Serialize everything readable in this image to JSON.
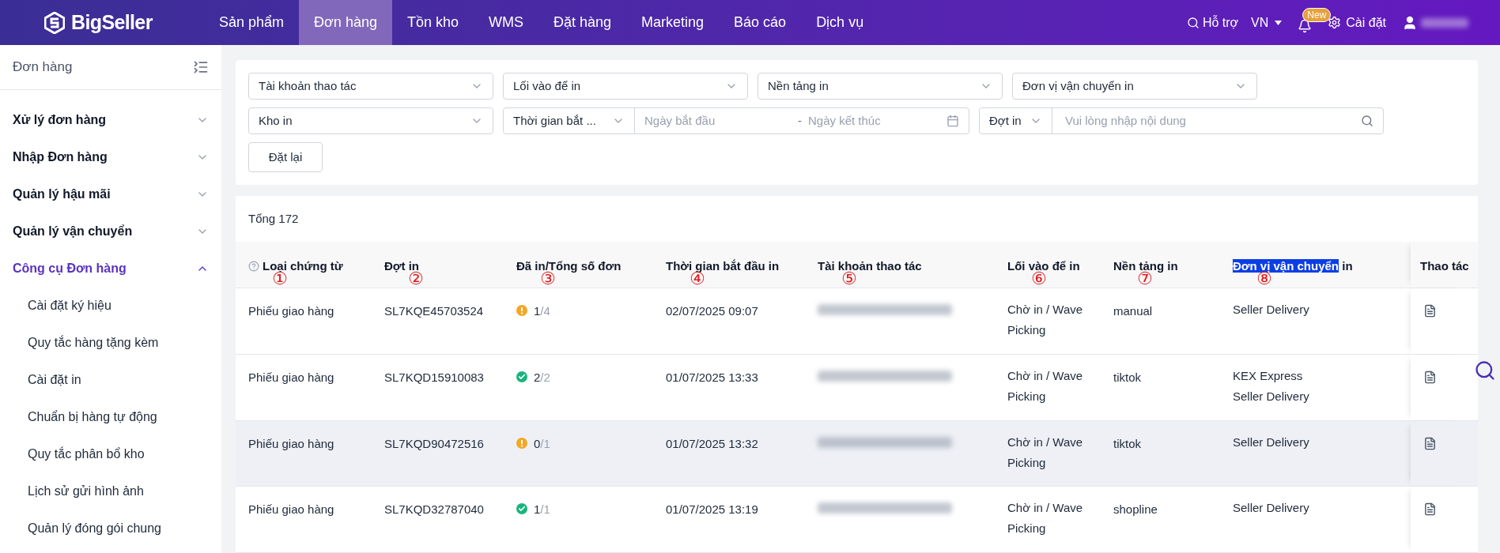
{
  "topnav": {
    "logo": "BigSeller",
    "items": [
      {
        "label": "Sản phẩm",
        "selected": false
      },
      {
        "label": "Đơn hàng",
        "selected": true
      },
      {
        "label": "Tồn kho",
        "selected": false
      },
      {
        "label": "WMS",
        "selected": false
      },
      {
        "label": "Đặt hàng",
        "selected": false
      },
      {
        "label": "Marketing",
        "selected": false
      },
      {
        "label": "Báo cáo",
        "selected": false
      },
      {
        "label": "Dịch vụ",
        "selected": false
      }
    ],
    "help": "Hỗ trợ",
    "language": "VN",
    "notification_badge": "New",
    "settings": "Cài đặt"
  },
  "sidebar": {
    "title": "Đơn hàng",
    "items": [
      {
        "label": "Xử lý đơn hàng",
        "expanded": false
      },
      {
        "label": "Nhập Đơn hàng",
        "expanded": false
      },
      {
        "label": "Quản lý hậu mãi",
        "expanded": false
      },
      {
        "label": "Quản lý vận chuyển",
        "expanded": false
      },
      {
        "label": "Công cụ Đơn hàng",
        "expanded": true,
        "children": [
          {
            "label": "Cài đặt ký hiệu"
          },
          {
            "label": "Quy tắc hàng tặng kèm"
          },
          {
            "label": "Cài đặt in"
          },
          {
            "label": "Chuẩn bị hàng tự động"
          },
          {
            "label": "Quy tắc phân bổ kho"
          },
          {
            "label": "Lịch sử gửi hình ảnh"
          },
          {
            "label": "Quản lý đóng gói chung"
          }
        ]
      }
    ]
  },
  "filters": {
    "row1": [
      {
        "placeholder": "Tài khoản thao tác"
      },
      {
        "placeholder": "Lối vào để in"
      },
      {
        "placeholder": "Nền tảng in"
      },
      {
        "placeholder": "Đơn vị vận chuyển in"
      }
    ],
    "warehouse": {
      "placeholder": "Kho in"
    },
    "date_type": "Thời gian bắt ...",
    "date_start": {
      "placeholder": "Ngày bắt đầu"
    },
    "date_separator": "-",
    "date_end": {
      "placeholder": "Ngày kết thúc"
    },
    "search_type": "Đợt in",
    "search": {
      "placeholder": "Vui lòng nhập nội dung"
    },
    "reset_button": "Đặt lại"
  },
  "table": {
    "total": "Tổng 172",
    "columns": [
      {
        "parts": [
          {
            "text": "Loại chứng từ",
            "highlighted": false
          }
        ],
        "marker": "①",
        "help_icon": true
      },
      {
        "parts": [
          {
            "text": "Đợt in",
            "highlighted": false
          }
        ],
        "marker": "②",
        "help_icon": false
      },
      {
        "parts": [
          {
            "text": "Đã in/Tổng số đơn",
            "highlighted": false
          }
        ],
        "marker": "③",
        "help_icon": false
      },
      {
        "parts": [
          {
            "text": "Thời gian bắt đầu in",
            "highlighted": false
          }
        ],
        "marker": "④",
        "help_icon": false
      },
      {
        "parts": [
          {
            "text": "Tài khoản thao tác",
            "highlighted": false
          }
        ],
        "marker": "⑤",
        "help_icon": false
      },
      {
        "parts": [
          {
            "text": "Lối vào để in",
            "highlighted": false
          }
        ],
        "marker": "⑥",
        "help_icon": false
      },
      {
        "parts": [
          {
            "text": "Nền tảng in",
            "highlighted": false
          }
        ],
        "marker": "⑦",
        "help_icon": false
      },
      {
        "parts": [
          {
            "text": "Đơn vị vận chuyển",
            "highlighted": true
          },
          {
            "text": " in",
            "highlighted": false
          }
        ],
        "marker": "⑧",
        "help_icon": false
      },
      {
        "parts": [
          {
            "text": "Thao tác",
            "highlighted": false
          }
        ],
        "help_icon": false
      }
    ],
    "rows": [
      {
        "highlighted": false,
        "type": "Phiếu giao hàng",
        "batch": "SL7KQE45703524",
        "kind": "warning",
        "printed": "1",
        "total": "/4",
        "start_time": "02/07/2025 09:07",
        "entry": "Chờ in / Wave Picking",
        "platform": "manual",
        "carriers": [
          "Seller Delivery"
        ]
      },
      {
        "highlighted": false,
        "type": "Phiếu giao hàng",
        "batch": "SL7KQD15910083",
        "kind": "success",
        "printed": "2",
        "total": "/2",
        "start_time": "01/07/2025 13:33",
        "entry": "Chờ in / Wave Picking",
        "platform": "tiktok",
        "carriers": [
          "KEX Express",
          "Seller Delivery"
        ]
      },
      {
        "highlighted": true,
        "type": "Phiếu giao hàng",
        "batch": "SL7KQD90472516",
        "kind": "warning",
        "printed": "0",
        "total": "/1",
        "start_time": "01/07/2025 13:32",
        "entry": "Chờ in / Wave Picking",
        "platform": "tiktok",
        "carriers": [
          "Seller Delivery"
        ]
      },
      {
        "highlighted": false,
        "type": "Phiếu giao hàng",
        "batch": "SL7KQD32787040",
        "kind": "success",
        "printed": "1",
        "total": "/1",
        "start_time": "01/07/2025 13:19",
        "entry": "Chờ in / Wave Picking",
        "platform": "shopline",
        "carriers": [
          "Seller Delivery"
        ]
      }
    ]
  }
}
